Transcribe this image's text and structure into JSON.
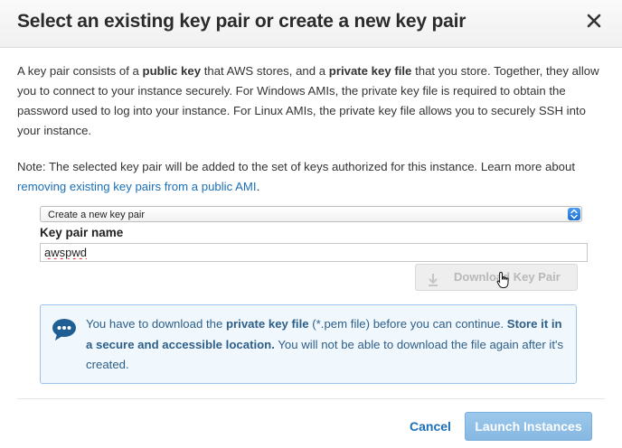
{
  "dialog": {
    "title": "Select an existing key pair or create a new key pair",
    "close_label": "×"
  },
  "intro": {
    "t1": "A key pair consists of a ",
    "b1": "public key",
    "t2": " that AWS stores, and a ",
    "b2": "private key file",
    "t3": " that you store. Together, they allow you to connect to your instance securely. For Windows AMIs, the private key file is required to obtain the password used to log into your instance. For Linux AMIs, the private key file allows you to securely SSH into your instance."
  },
  "note": {
    "text": "Note: The selected key pair will be added to the set of keys authorized for this instance. Learn more about ",
    "link": "removing existing key pairs from a public AMI",
    "end": "."
  },
  "keypair": {
    "select_value": "Create a new key pair",
    "name_label": "Key pair name",
    "name_value": "awspwd",
    "download_label": "Download Key Pair"
  },
  "info": {
    "t1": "You have to download the ",
    "b1": "private key file",
    "t2": " (*.pem file) before you can continue. ",
    "b2": "Store it in a secure and accessible location.",
    "t3": " You will not be able to download the file again after it's created."
  },
  "footer": {
    "cancel_label": "Cancel",
    "launch_label": "Launch Instances"
  },
  "colors": {
    "link": "#1a6fb7",
    "info_border": "#9ac4ea",
    "info_bg": "#f0f7fd",
    "primary_disabled": "#8fbfe6"
  }
}
